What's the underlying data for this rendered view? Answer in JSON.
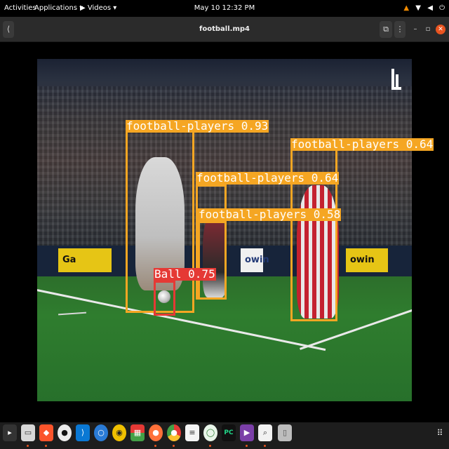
{
  "topbar": {
    "activities": "Activities",
    "applications": "Applications ▾",
    "videos": "▶ Videos ▾",
    "clock": "May 10  12:32 PM",
    "tray_icons": [
      "vlc-icon",
      "network-icon",
      "volume-icon",
      "power-icon"
    ]
  },
  "window": {
    "title": "football.mp4",
    "back_glyph": "⟨",
    "mirror_glyph": "⧉",
    "menu_glyph": "⋮",
    "minimize_glyph": "–",
    "maximize_glyph": "▫",
    "close_glyph": "✕"
  },
  "video": {
    "ads": [
      "Ga",
      "owin",
      "owin"
    ],
    "detections": [
      {
        "label": "football-players 0.93",
        "class": "football-players",
        "confidence": 0.93
      },
      {
        "label": "football-players 0.64",
        "class": "football-players",
        "confidence": 0.64
      },
      {
        "label": "football-players 0.64",
        "class": "football-players",
        "confidence": 0.64
      },
      {
        "label": "football-players 0.58",
        "class": "football-players",
        "confidence": 0.58
      },
      {
        "label": "Ball 0.75",
        "class": "Ball",
        "confidence": 0.75
      }
    ]
  },
  "dock": {
    "apps": [
      "terminal-icon",
      "files-icon",
      "brave-icon",
      "github-icon",
      "vscode-icon",
      "vlc-icon",
      "rhythmbox-icon",
      "vlc-media-icon",
      "firefox-icon",
      "chrome-icon",
      "text-editor-icon",
      "video-player-icon",
      "pycharm-icon",
      "videos-app-icon",
      "image-viewer-icon",
      "trash-icon"
    ],
    "show_apps_glyph": "⋮⋮⋮"
  },
  "colors": {
    "player_box": "#f5a623",
    "ball_box": "#e53935",
    "accent": "#e95420"
  }
}
